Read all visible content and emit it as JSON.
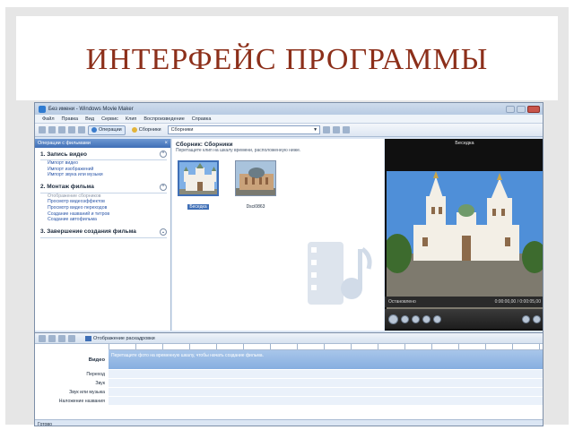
{
  "slide": {
    "title": "ИНТЕРФЕЙС ПРОГРАММЫ"
  },
  "window": {
    "title": "Без имени - Windows Movie Maker"
  },
  "menu": [
    "Файл",
    "Правка",
    "Вид",
    "Сервис",
    "Клип",
    "Воспроизведение",
    "Справка"
  ],
  "toolbar": {
    "tasks_label": "Операции",
    "collections_label": "Сборники",
    "collection_select": "Сборники"
  },
  "tasks_pane": {
    "header": "Операции с фильмами",
    "sections": [
      {
        "title": "1. Запись видео",
        "links": [
          "Импорт видео",
          "Импорт изображений",
          "Импорт звука или музыки"
        ]
      },
      {
        "title": "2. Монтаж фильма",
        "links": [
          "Отображение сборников",
          "Просмотр видеоэффектов",
          "Просмотр видео переходов",
          "Создание названий и титров",
          "Создание автофильма"
        ]
      },
      {
        "title": "3. Завершение создания фильма",
        "links": []
      }
    ]
  },
  "collection": {
    "title": "Сборник: Сборники",
    "subtitle": "Перетащите клип на шкалу времени, расположенную ниже.",
    "items": [
      {
        "caption": "Беседка",
        "selected": true
      },
      {
        "caption": "Dsci0863",
        "selected": false
      }
    ]
  },
  "preview": {
    "title": "Беседка",
    "status": "Остановлено",
    "time": "0:00:00,00 / 0:00:05,00"
  },
  "timeline": {
    "mode_label": "Отображение раскадровки",
    "tracks": [
      "Видео",
      "Переход",
      "Звук",
      "Звук или музыка",
      "Наложение названия"
    ],
    "video_hint": "Перетащите фото на временную шкалу, чтобы начать создание фильма."
  },
  "status": {
    "text": "Готово"
  },
  "colors": {
    "title": "#8c2f1a",
    "accent": "#3f6fb6",
    "link": "#2b56a8"
  }
}
